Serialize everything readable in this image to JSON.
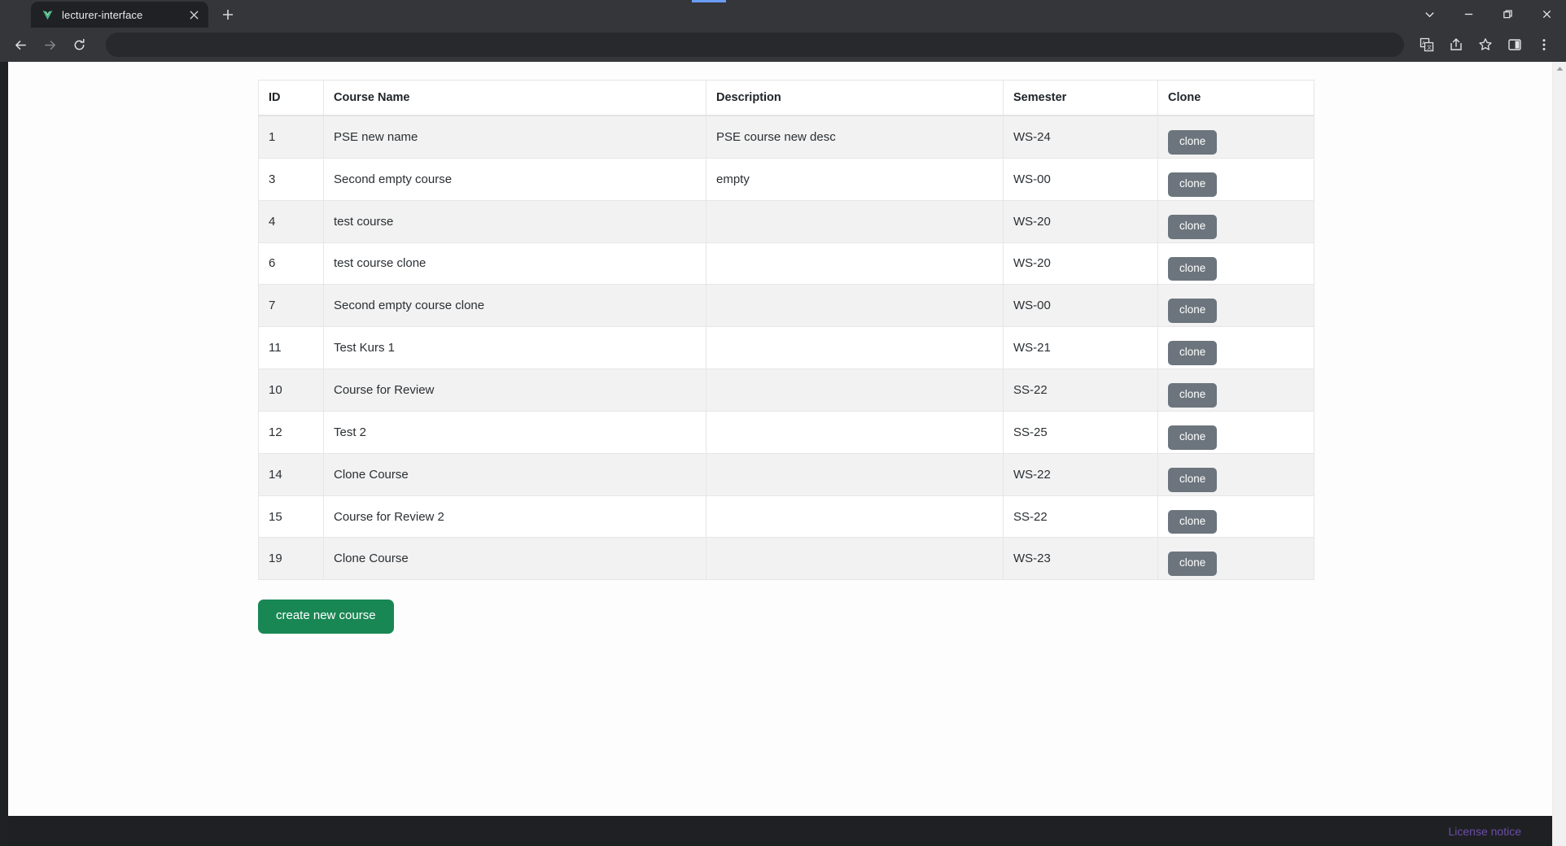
{
  "browser": {
    "tab": {
      "title": "lecturer-interface",
      "favicon_icon": "vite-v-logo-icon",
      "close_icon": "close-icon"
    },
    "new_tab_label": "+",
    "window_controls": [
      {
        "name": "minimize-to-tray-chevron",
        "glyph": "⌄"
      },
      {
        "name": "minimize",
        "glyph": "—"
      },
      {
        "name": "maximize-restore",
        "glyph": "❐"
      },
      {
        "name": "close",
        "glyph": "✕"
      }
    ],
    "toolbar": {
      "back_icon": "back-arrow-icon",
      "forward_icon": "forward-arrow-icon",
      "reload_icon": "reload-icon",
      "address_value": "",
      "address_placeholder": "",
      "translate_icon": "translate-icon",
      "share_icon": "share-icon",
      "bookmark_icon": "star-icon",
      "side_panel_icon": "side-panel-icon",
      "menu_icon": "three-dot-menu-icon"
    }
  },
  "page": {
    "table": {
      "headers": {
        "id": "ID",
        "name": "Course Name",
        "description": "Description",
        "semester": "Semester",
        "clone": "Clone"
      },
      "clone_button_label": "clone",
      "rows": [
        {
          "id": "1",
          "name": "PSE new name",
          "description": "PSE course new desc",
          "semester": "WS-24"
        },
        {
          "id": "3",
          "name": "Second empty course",
          "description": "empty",
          "semester": "WS-00"
        },
        {
          "id": "4",
          "name": "test course",
          "description": "",
          "semester": "WS-20"
        },
        {
          "id": "6",
          "name": "test course clone",
          "description": "",
          "semester": "WS-20"
        },
        {
          "id": "7",
          "name": "Second empty course clone",
          "description": "",
          "semester": "WS-00"
        },
        {
          "id": "11",
          "name": "Test Kurs 1",
          "description": "",
          "semester": "WS-21"
        },
        {
          "id": "10",
          "name": "Course for Review",
          "description": "",
          "semester": "SS-22"
        },
        {
          "id": "12",
          "name": "Test 2",
          "description": "",
          "semester": "SS-25"
        },
        {
          "id": "14",
          "name": "Clone Course",
          "description": "",
          "semester": "WS-22"
        },
        {
          "id": "15",
          "name": "Course for Review 2",
          "description": "",
          "semester": "SS-22"
        },
        {
          "id": "19",
          "name": "Clone Course",
          "description": "",
          "semester": "WS-23"
        }
      ]
    },
    "create_button_label": "create new course",
    "footer": {
      "license_link": "License notice",
      "link_color": "#6b4ea8"
    }
  },
  "colors": {
    "clone_button": "#6c757d",
    "create_button": "#198754",
    "row_stripe": "#f2f2f2",
    "chrome": "#35363a"
  }
}
